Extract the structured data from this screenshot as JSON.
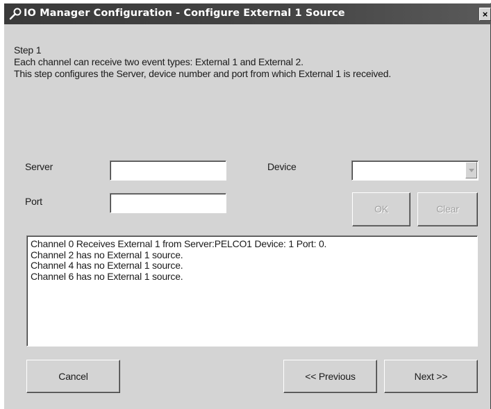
{
  "window": {
    "title": "IO Manager Configuration - Configure External 1 Source",
    "close_glyph": "×",
    "icon": "wrench-icon"
  },
  "intro": {
    "step": "Step 1",
    "line1": "Each channel can receive two event types: External 1 and External 2.",
    "line2": "This step configures the Server, device number and port from which External 1 is received."
  },
  "form": {
    "server_label": "Server",
    "server_value": "",
    "port_label": "Port",
    "port_value": "",
    "device_label": "Device",
    "device_value": ""
  },
  "actions": {
    "ok_label": "OK",
    "clear_label": "Clear"
  },
  "channels": [
    "Channel 0 Receives External 1 from Server:PELCO1 Device: 1 Port: 0.",
    "Channel 2 has no External 1 source.",
    "Channel 4 has no External 1 source.",
    "Channel 6 has no External 1 source."
  ],
  "nav": {
    "cancel_label": "Cancel",
    "previous_label": "<< Previous",
    "next_label": "Next >>"
  },
  "colors": {
    "dialog_bg": "#d4d4d4",
    "titlebar": "#3a3a3a",
    "disabled_text": "#a0a0a0"
  }
}
